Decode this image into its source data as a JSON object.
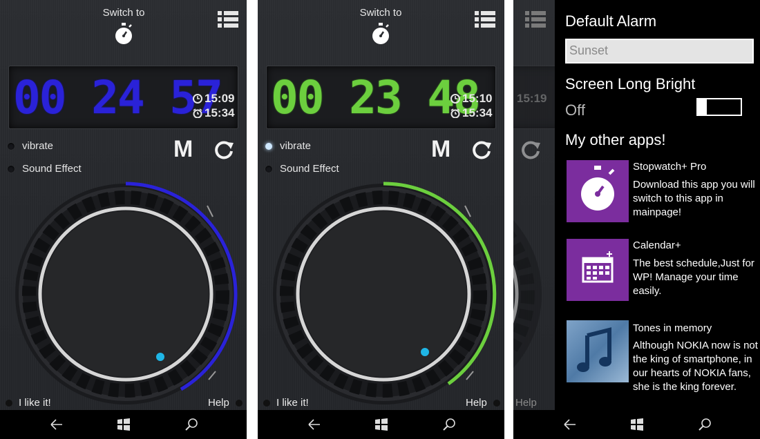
{
  "colors": {
    "phone1_accent": "#2a22d8",
    "phone2_accent": "#6ccf3e",
    "dot": "#1fb6e6",
    "tile_purple": "#7b2d9e"
  },
  "phone1": {
    "switch_label": "Switch to",
    "digits": "00 24 57",
    "lap_time": "15:09",
    "alarm_time": "15:34",
    "vibrate_label": "vibrate",
    "vibrate_on": false,
    "sound_label": "Sound Effect",
    "m_label": "M",
    "like_label": "I like it!",
    "help_label": "Help"
  },
  "phone2": {
    "switch_label": "Switch to",
    "digits": "00 23 48",
    "lap_time": "15:10",
    "alarm_time": "15:34",
    "vibrate_label": "vibrate",
    "vibrate_on": true,
    "sound_label": "Sound Effect",
    "m_label": "M",
    "like_label": "I like it!",
    "help_label": "Help"
  },
  "phone3_partial": {
    "lap_time": "15:19",
    "help_label": "Help"
  },
  "settings": {
    "default_alarm_heading": "Default Alarm",
    "default_alarm_value": "Sunset",
    "screen_bright_heading": "Screen Long Bright",
    "screen_bright_state": "Off",
    "other_apps_heading": "My other apps!",
    "apps": [
      {
        "name": "Stopwatch+ Pro",
        "description": "Download this app you will switch to this app in mainpage!",
        "icon": "stopwatch-icon"
      },
      {
        "name": "Calendar+",
        "description": "The best schedule,Just for WP! Manage your time easily.",
        "icon": "calendar-icon"
      },
      {
        "name": "Tones in memory",
        "description": "Although NOKIA now is not the king of smartphone, in our hearts of NOKIA fans, she is the king forever.",
        "icon": "music-note-icon"
      }
    ]
  },
  "navbar": {
    "icons": [
      "back-icon",
      "windows-icon",
      "search-icon"
    ]
  }
}
